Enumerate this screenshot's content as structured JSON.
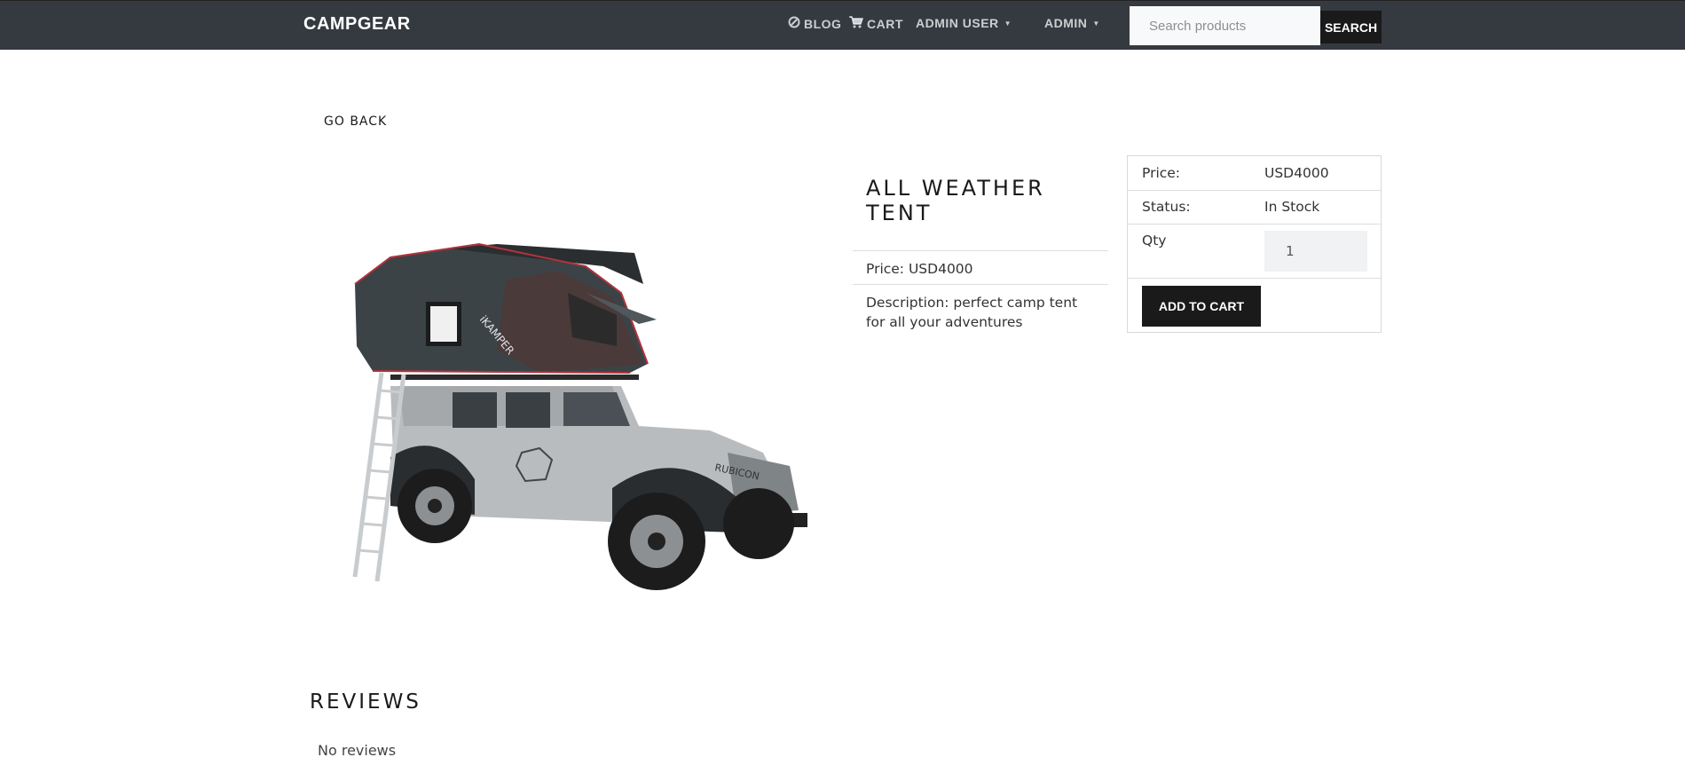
{
  "navbar": {
    "brand": "CAMPGEAR",
    "blog": "BLOG",
    "cart": "CART",
    "user_menu": "ADMIN USER",
    "admin_menu": "ADMIN",
    "search_placeholder": "Search products",
    "search_button": "SEARCH",
    "background": "#343a40"
  },
  "go_back": "GO BACK",
  "product": {
    "title": "ALL WEATHER TENT",
    "price_line": "Price: USD4000",
    "description_line": "Description: perfect camp tent for all your adventures"
  },
  "buy_card": {
    "price_label": "Price:",
    "price_value": "USD4000",
    "status_label": "Status:",
    "status_value": "In Stock",
    "qty_label": "Qty",
    "qty_value": "1",
    "add_to_cart": "ADD TO CART"
  },
  "reviews": {
    "title": "REVIEWS",
    "empty": "No reviews"
  }
}
